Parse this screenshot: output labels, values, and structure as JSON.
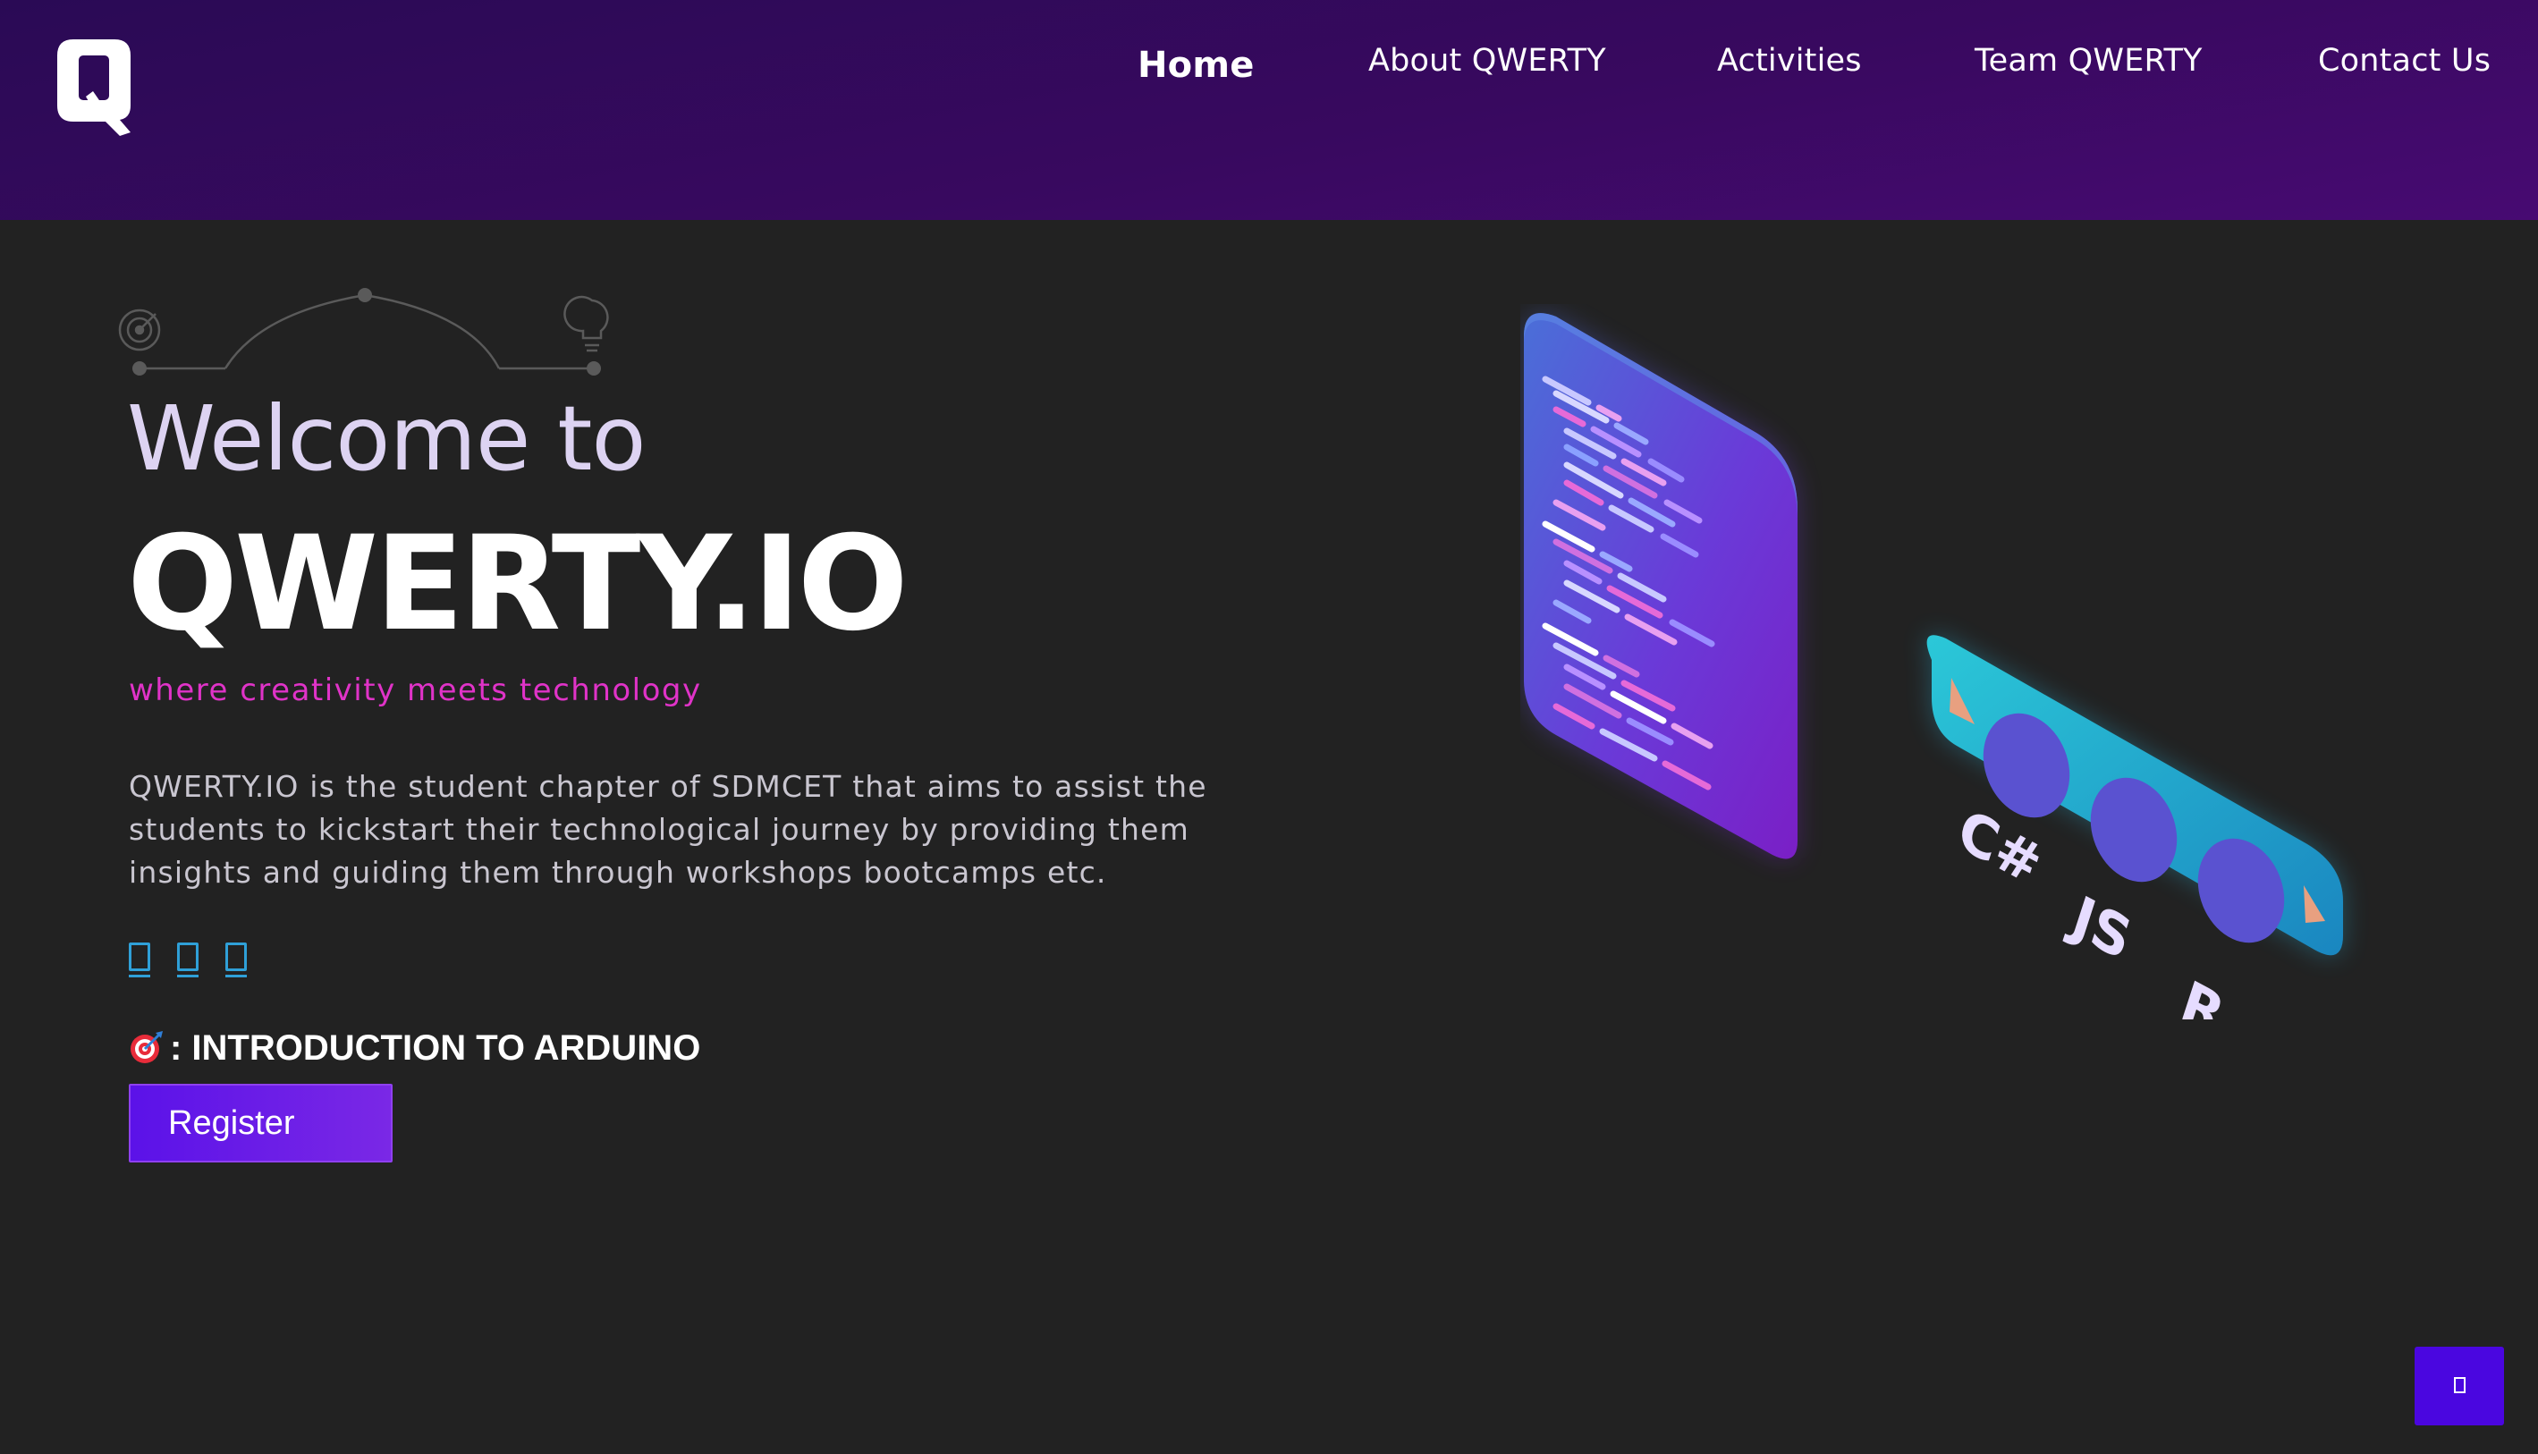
{
  "nav": {
    "logo_icon": "q-logo-icon",
    "items": [
      {
        "label": "Home",
        "active": true
      },
      {
        "label": "About QWERTY",
        "active": false
      },
      {
        "label": "Activities",
        "active": false
      },
      {
        "label": "Team QWERTY",
        "active": false
      },
      {
        "label": "Contact Us",
        "active": false
      }
    ]
  },
  "hero": {
    "welcome": "Welcome to",
    "brand": "QWERTY.IO",
    "tagline": "where creativity meets technology",
    "description": "QWERTY.IO is the student chapter of SDMCET that aims to assist the students to kickstart their technological journey by providing them insights and guiding them through workshops bootcamps etc.",
    "social_icons": [
      "social-icon-1",
      "social-icon-2",
      "social-icon-3"
    ],
    "event_icon": "target-icon",
    "event_text": ": INTRODUCTION TO ARDUINO",
    "register_label": "Register"
  },
  "illustration": {
    "languages": [
      "C#",
      "JS",
      "R"
    ]
  },
  "colors": {
    "background": "#222222",
    "nav_gradient_start": "#2a0a55",
    "nav_gradient_end": "#470a72",
    "tagline": "#e033c8",
    "accent_button": "#5b12e8",
    "social_icon": "#2fa0d8"
  },
  "back_to_top_icon": "arrow-up-icon"
}
